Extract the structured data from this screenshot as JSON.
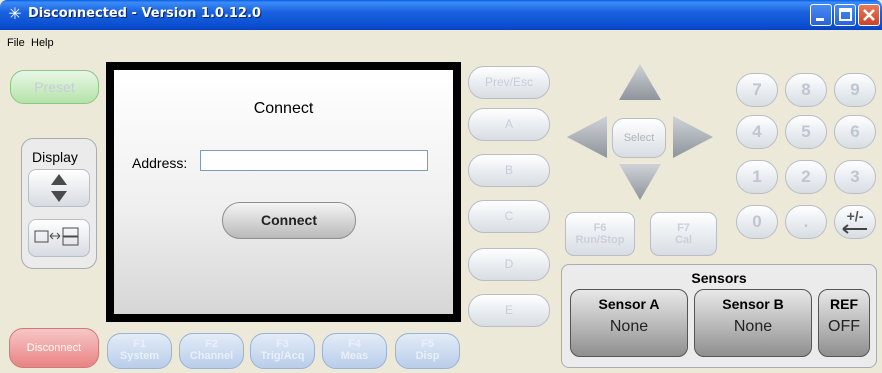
{
  "window": {
    "title": "Disconnected - Version 1.0.12.0"
  },
  "menu": {
    "file": "File",
    "help": "Help"
  },
  "left": {
    "preset": "Preset",
    "display": "Display",
    "disconnect": "Disconnect"
  },
  "dialog": {
    "title": "Connect",
    "address_label": "Address:",
    "address_value": "",
    "connect_button": "Connect"
  },
  "softkeys": [
    "Prev/Esc",
    "A",
    "B",
    "C",
    "D",
    "E"
  ],
  "nav": {
    "select": "Select"
  },
  "fkeys_side": [
    {
      "line1": "F6",
      "line2": "Run/Stop"
    },
    {
      "line1": "F7",
      "line2": "Cal"
    }
  ],
  "fkeys_bottom": [
    {
      "line1": "F1",
      "line2": "System"
    },
    {
      "line1": "F2",
      "line2": "Channel"
    },
    {
      "line1": "F3",
      "line2": "Trig/Acq"
    },
    {
      "line1": "F4",
      "line2": "Meas"
    },
    {
      "line1": "F5",
      "line2": "Disp"
    }
  ],
  "numpad": [
    "7",
    "8",
    "9",
    "4",
    "5",
    "6",
    "1",
    "2",
    "3",
    "0",
    ".",
    "+/-"
  ],
  "sensors": {
    "title": "Sensors",
    "a": {
      "label": "Sensor A",
      "value": "None"
    },
    "b": {
      "label": "Sensor B",
      "value": "None"
    },
    "ref": {
      "label": "REF",
      "value": "OFF"
    }
  }
}
